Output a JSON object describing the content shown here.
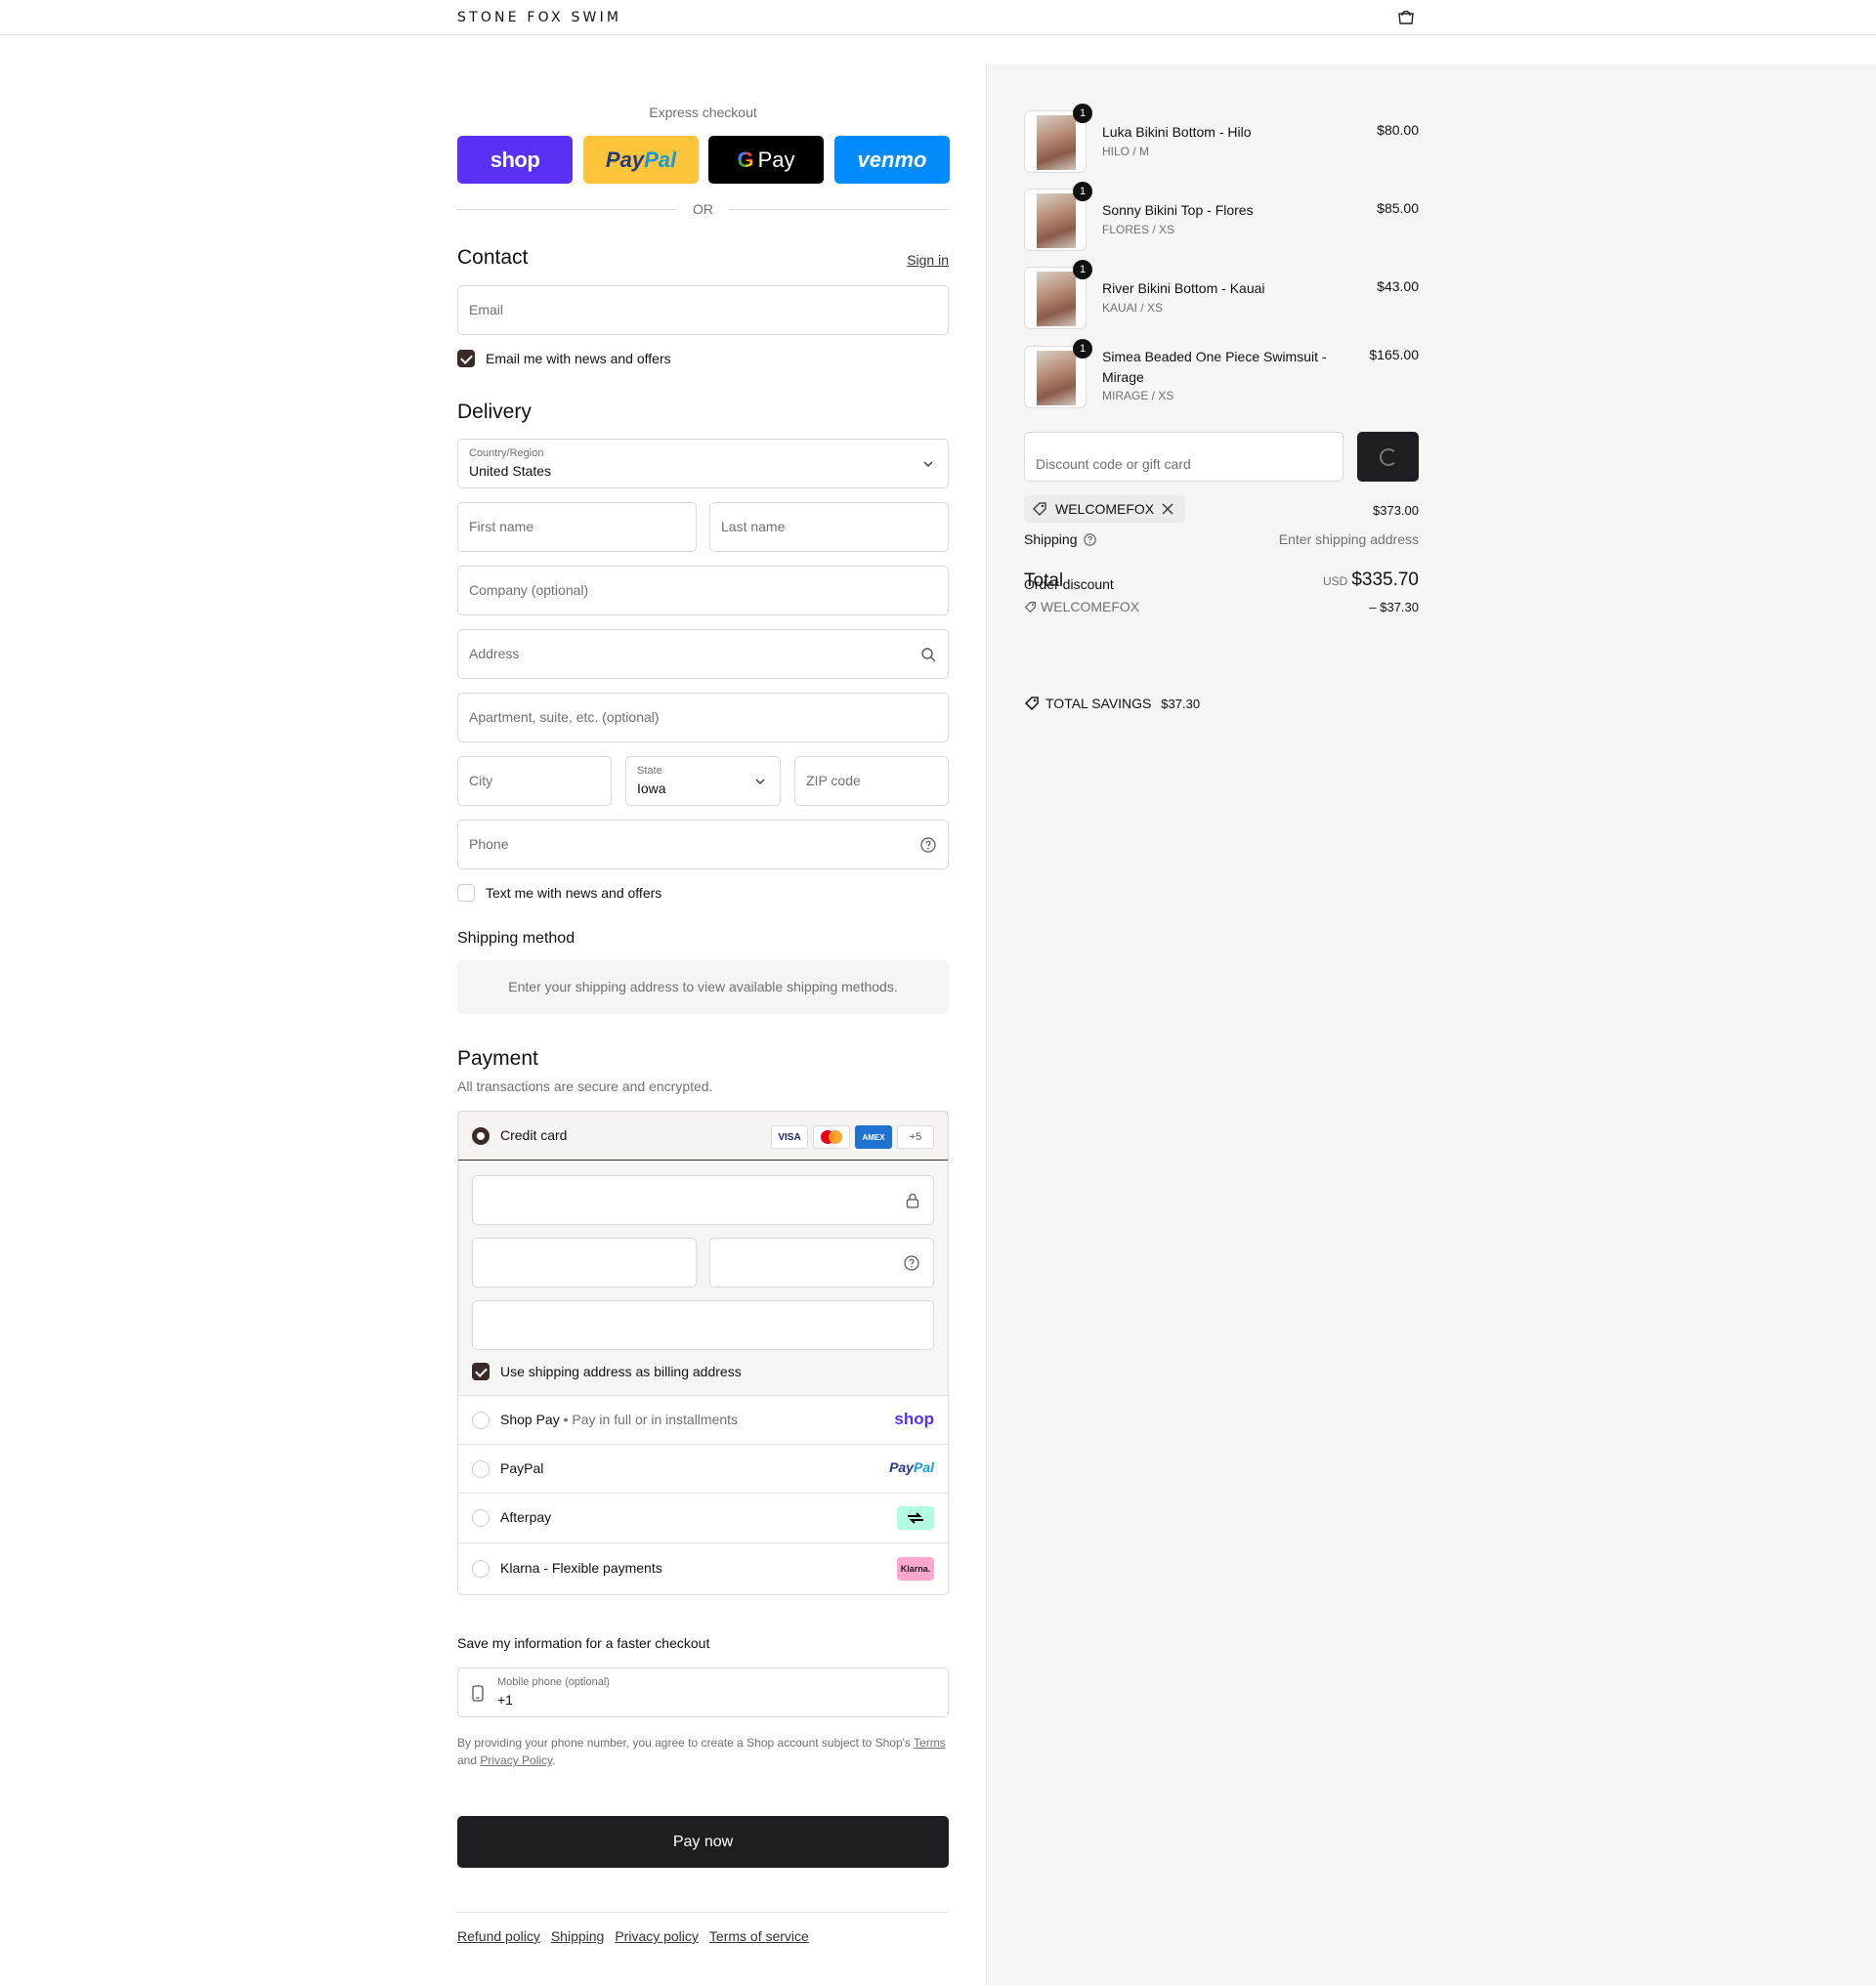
{
  "header": {
    "logo": "STONE FOX SWIM",
    "cart_icon": "bag-icon"
  },
  "express": {
    "title": "Express checkout",
    "buttons": {
      "shop": "shop",
      "paypal_a": "Pay",
      "paypal_b": "Pal",
      "gpay_g": "G",
      "gpay": "Pay",
      "venmo": "venmo"
    },
    "or": "OR"
  },
  "contact": {
    "heading": "Contact",
    "sign_in": "Sign in",
    "email_placeholder": "Email",
    "news_label": "Email me with news and offers"
  },
  "delivery": {
    "heading": "Delivery",
    "country_label": "Country/Region",
    "country_value": "United States",
    "first_name": "First name",
    "last_name": "Last name",
    "company": "Company (optional)",
    "address": "Address",
    "apartment": "Apartment, suite, etc. (optional)",
    "city": "City",
    "state_label": "State",
    "state_value": "Iowa",
    "zip": "ZIP code",
    "phone": "Phone",
    "text_label": "Text me with news and offers"
  },
  "shipping": {
    "heading": "Shipping method",
    "notice": "Enter your shipping address to view available shipping methods."
  },
  "payment": {
    "heading": "Payment",
    "subtitle": "All transactions are secure and encrypted.",
    "credit_card": "Credit card",
    "card_brands": [
      "VISA",
      "",
      "AMEX",
      "+5"
    ],
    "billing_label": "Use shipping address as billing address",
    "shop_pay": "Shop Pay",
    "shop_pay_note": "Pay in full or in installments",
    "shop_logo": "shop",
    "paypal": "PayPal",
    "paypal_logo_a": "Pay",
    "paypal_logo_b": "Pal",
    "afterpay": "Afterpay",
    "klarna": "Klarna - Flexible payments",
    "klarna_logo": "Klarna."
  },
  "save_info": {
    "heading": "Save my information for a faster checkout",
    "phone_label": "Mobile phone (optional)",
    "phone_value": "+1",
    "legal_a": "By providing your phone number, you agree to create a Shop account subject to Shop's ",
    "terms": "Terms",
    "legal_b": "and ",
    "privacy": "Privacy Policy",
    "legal_c": "."
  },
  "pay_now": "Pay now",
  "footer": [
    "Refund policy",
    "Shipping",
    "Privacy policy",
    "Terms of service"
  ],
  "cart": {
    "items": [
      {
        "name": "Luka Bikini Bottom - Hilo",
        "variant": "HILO / M",
        "price": "$80.00",
        "qty": "1"
      },
      {
        "name": "Sonny Bikini Top - Flores",
        "variant": "FLORES / XS",
        "price": "$85.00",
        "qty": "1"
      },
      {
        "name": "River Bikini Bottom - Kauai",
        "variant": "KAUAI / XS",
        "price": "$43.00",
        "qty": "1"
      },
      {
        "name": "Simea Beaded One Piece Swimsuit - Mirage",
        "variant": "MIRAGE / XS",
        "price": "$165.00",
        "qty": "1"
      }
    ],
    "discount_placeholder": "Discount code or gift card",
    "applied_code": "WELCOMEFOX",
    "subtotal": "$373.00",
    "shipping_label": "Shipping",
    "shipping_value": "Enter shipping address",
    "total_label": "Total",
    "order_discount_label": "Order discount",
    "currency": "USD",
    "total": "$335.70",
    "discount_code": "WELCOMEFOX",
    "discount_amount": "– $37.30",
    "savings_label": "TOTAL SAVINGS",
    "savings_value": "$37.30"
  }
}
